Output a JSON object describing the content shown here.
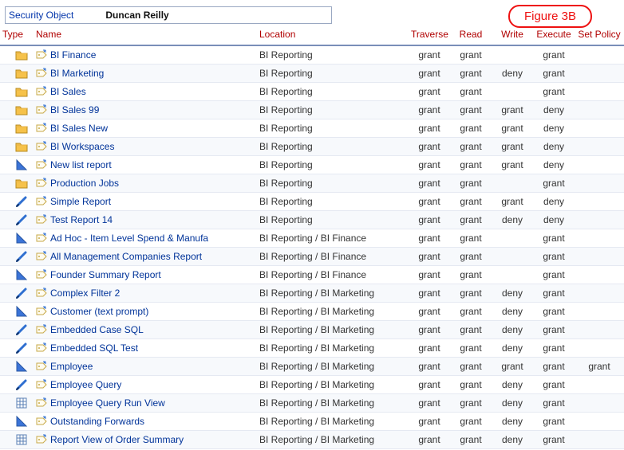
{
  "figure_label": "Figure 3B",
  "header": {
    "label": "Security Object",
    "value": "Duncan Reilly"
  },
  "columns": {
    "type": "Type",
    "name": "Name",
    "location": "Location",
    "traverse": "Traverse",
    "read": "Read",
    "write": "Write",
    "execute": "Execute",
    "setpolicy": "Set Policy"
  },
  "rows": [
    {
      "icon": "folder",
      "name": "BI Finance",
      "location": "BI Reporting",
      "traverse": "grant",
      "read": "grant",
      "write": "",
      "execute": "grant",
      "setpolicy": ""
    },
    {
      "icon": "folder",
      "name": "BI Marketing",
      "location": "BI Reporting",
      "traverse": "grant",
      "read": "grant",
      "write": "deny",
      "execute": "grant",
      "setpolicy": ""
    },
    {
      "icon": "folder",
      "name": "BI Sales",
      "location": "BI Reporting",
      "traverse": "grant",
      "read": "grant",
      "write": "",
      "execute": "grant",
      "setpolicy": ""
    },
    {
      "icon": "folder",
      "name": "BI Sales 99",
      "location": "BI Reporting",
      "traverse": "grant",
      "read": "grant",
      "write": "grant",
      "execute": "deny",
      "setpolicy": ""
    },
    {
      "icon": "folder",
      "name": "BI Sales New",
      "location": "BI Reporting",
      "traverse": "grant",
      "read": "grant",
      "write": "grant",
      "execute": "deny",
      "setpolicy": ""
    },
    {
      "icon": "folder",
      "name": "BI Workspaces",
      "location": "BI Reporting",
      "traverse": "grant",
      "read": "grant",
      "write": "grant",
      "execute": "deny",
      "setpolicy": ""
    },
    {
      "icon": "triangle",
      "name": "New list report",
      "location": "BI Reporting",
      "traverse": "grant",
      "read": "grant",
      "write": "grant",
      "execute": "deny",
      "setpolicy": ""
    },
    {
      "icon": "folder",
      "name": "Production Jobs",
      "location": "BI Reporting",
      "traverse": "grant",
      "read": "grant",
      "write": "",
      "execute": "grant",
      "setpolicy": ""
    },
    {
      "icon": "pen",
      "name": "Simple Report",
      "location": "BI Reporting",
      "traverse": "grant",
      "read": "grant",
      "write": "grant",
      "execute": "deny",
      "setpolicy": ""
    },
    {
      "icon": "pen",
      "name": "Test Report 14",
      "location": "BI Reporting",
      "traverse": "grant",
      "read": "grant",
      "write": "deny",
      "execute": "deny",
      "setpolicy": ""
    },
    {
      "icon": "triangle",
      "name": "Ad Hoc - Item Level Spend & Manufa",
      "location": "BI Reporting / BI Finance",
      "traverse": "grant",
      "read": "grant",
      "write": "",
      "execute": "grant",
      "setpolicy": ""
    },
    {
      "icon": "pen",
      "name": "All Management Companies Report",
      "location": "BI Reporting / BI Finance",
      "traverse": "grant",
      "read": "grant",
      "write": "",
      "execute": "grant",
      "setpolicy": ""
    },
    {
      "icon": "triangle",
      "name": "Founder Summary Report",
      "location": "BI Reporting / BI Finance",
      "traverse": "grant",
      "read": "grant",
      "write": "",
      "execute": "grant",
      "setpolicy": ""
    },
    {
      "icon": "pen",
      "name": "Complex Filter 2",
      "location": "BI Reporting / BI Marketing",
      "traverse": "grant",
      "read": "grant",
      "write": "deny",
      "execute": "grant",
      "setpolicy": ""
    },
    {
      "icon": "triangle",
      "name": "Customer (text prompt)",
      "location": "BI Reporting / BI Marketing",
      "traverse": "grant",
      "read": "grant",
      "write": "deny",
      "execute": "grant",
      "setpolicy": ""
    },
    {
      "icon": "pen",
      "name": "Embedded Case SQL",
      "location": "BI Reporting / BI Marketing",
      "traverse": "grant",
      "read": "grant",
      "write": "deny",
      "execute": "grant",
      "setpolicy": ""
    },
    {
      "icon": "pen",
      "name": "Embedded SQL Test",
      "location": "BI Reporting / BI Marketing",
      "traverse": "grant",
      "read": "grant",
      "write": "deny",
      "execute": "grant",
      "setpolicy": ""
    },
    {
      "icon": "triangle",
      "name": "Employee",
      "location": "BI Reporting / BI Marketing",
      "traverse": "grant",
      "read": "grant",
      "write": "grant",
      "execute": "grant",
      "setpolicy": "grant"
    },
    {
      "icon": "pen",
      "name": "Employee Query",
      "location": "BI Reporting / BI Marketing",
      "traverse": "grant",
      "read": "grant",
      "write": "deny",
      "execute": "grant",
      "setpolicy": ""
    },
    {
      "icon": "grid",
      "name": "Employee Query Run View",
      "location": "BI Reporting / BI Marketing",
      "traverse": "grant",
      "read": "grant",
      "write": "deny",
      "execute": "grant",
      "setpolicy": ""
    },
    {
      "icon": "triangle",
      "name": "Outstanding Forwards",
      "location": "BI Reporting / BI Marketing",
      "traverse": "grant",
      "read": "grant",
      "write": "deny",
      "execute": "grant",
      "setpolicy": ""
    },
    {
      "icon": "grid",
      "name": "Report View of Order Summary",
      "location": "BI Reporting / BI Marketing",
      "traverse": "grant",
      "read": "grant",
      "write": "deny",
      "execute": "grant",
      "setpolicy": ""
    }
  ]
}
